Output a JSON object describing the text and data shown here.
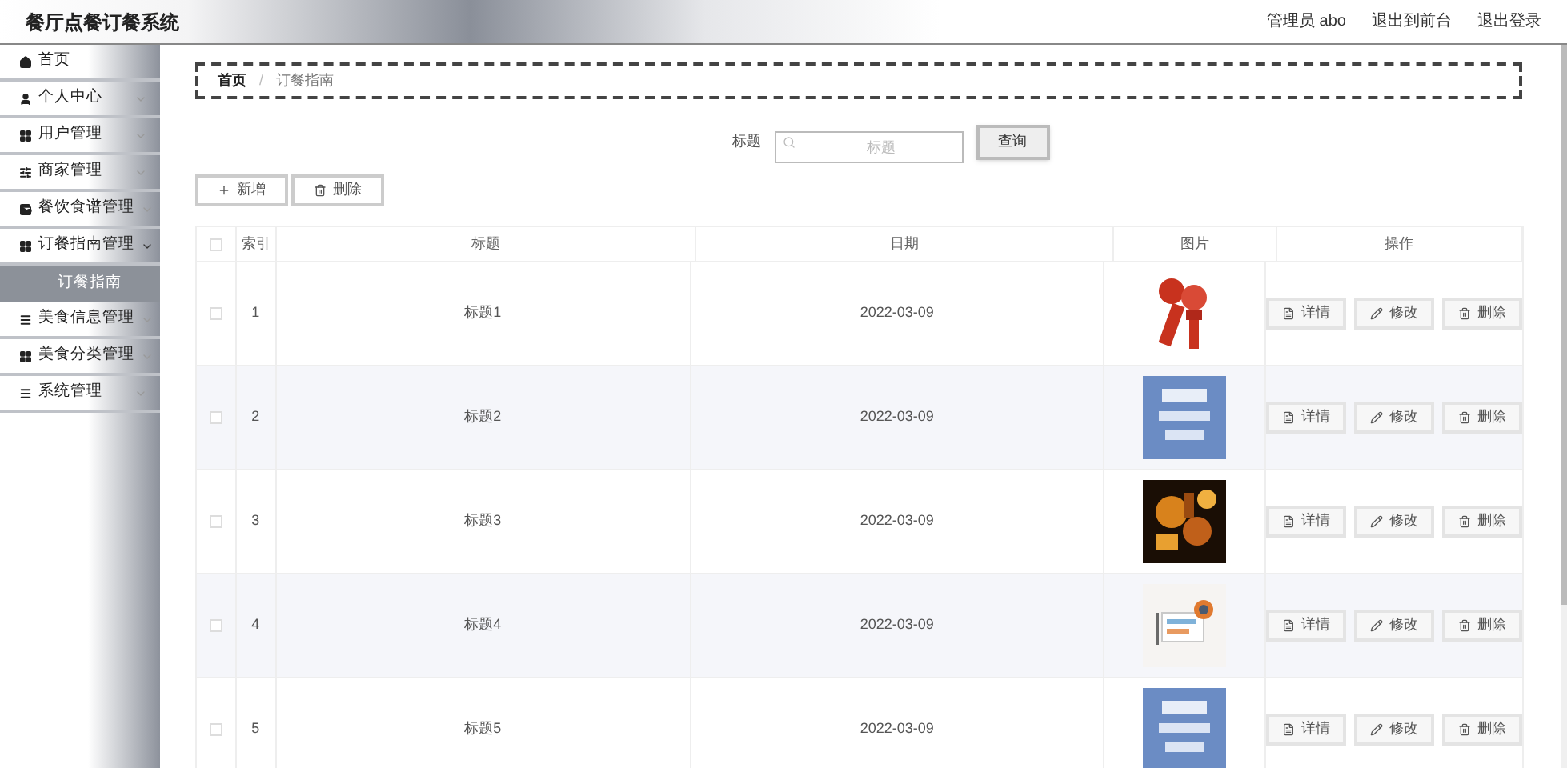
{
  "header": {
    "title": "餐厅点餐订餐系统",
    "user": "管理员 abo",
    "links": [
      "退出到前台",
      "退出登录"
    ]
  },
  "sidebar": {
    "items": [
      {
        "label": "首页",
        "kind": "link"
      },
      {
        "label": "个人中心",
        "kind": "menu",
        "expanded": false
      },
      {
        "label": "用户管理",
        "kind": "menu",
        "expanded": false
      },
      {
        "label": "商家管理",
        "kind": "menu",
        "expanded": false
      },
      {
        "label": "餐饮食谱管理",
        "kind": "menu",
        "expanded": false
      },
      {
        "label": "订餐指南管理",
        "kind": "menu",
        "expanded": true,
        "children": [
          {
            "label": "订餐指南",
            "selected": true
          }
        ]
      },
      {
        "label": "美食信息管理",
        "kind": "menu",
        "expanded": false
      },
      {
        "label": "美食分类管理",
        "kind": "menu",
        "expanded": false
      },
      {
        "label": "系统管理",
        "kind": "menu",
        "expanded": false
      }
    ]
  },
  "breadcrumb": {
    "items": [
      "首页",
      "订餐指南"
    ],
    "separator": "/"
  },
  "search": {
    "label": "标题",
    "placeholder": "标题",
    "button": "查询"
  },
  "toolbar": [
    "新增",
    "删除"
  ],
  "table": {
    "all_checked": false,
    "columns": [
      "索引",
      "标题",
      "日期",
      "图片",
      "操作"
    ],
    "rows": [
      {
        "checked": false,
        "index": "1",
        "title": "标题1",
        "date": "2022-03-09",
        "actions": [
          "详情",
          "修改",
          "删除"
        ]
      },
      {
        "checked": false,
        "index": "2",
        "title": "标题2",
        "date": "2022-03-09",
        "actions": [
          "详情",
          "修改",
          "删除"
        ]
      },
      {
        "checked": false,
        "index": "3",
        "title": "标题3",
        "date": "2022-03-09",
        "actions": [
          "详情",
          "修改",
          "删除"
        ]
      },
      {
        "checked": false,
        "index": "4",
        "title": "标题4",
        "date": "2022-03-09",
        "actions": [
          "详情",
          "修改",
          "删除"
        ]
      },
      {
        "checked": false,
        "index": "5",
        "title": "标题5",
        "date": "2022-03-09",
        "actions": [
          "详情",
          "修改",
          "删除"
        ]
      }
    ]
  }
}
